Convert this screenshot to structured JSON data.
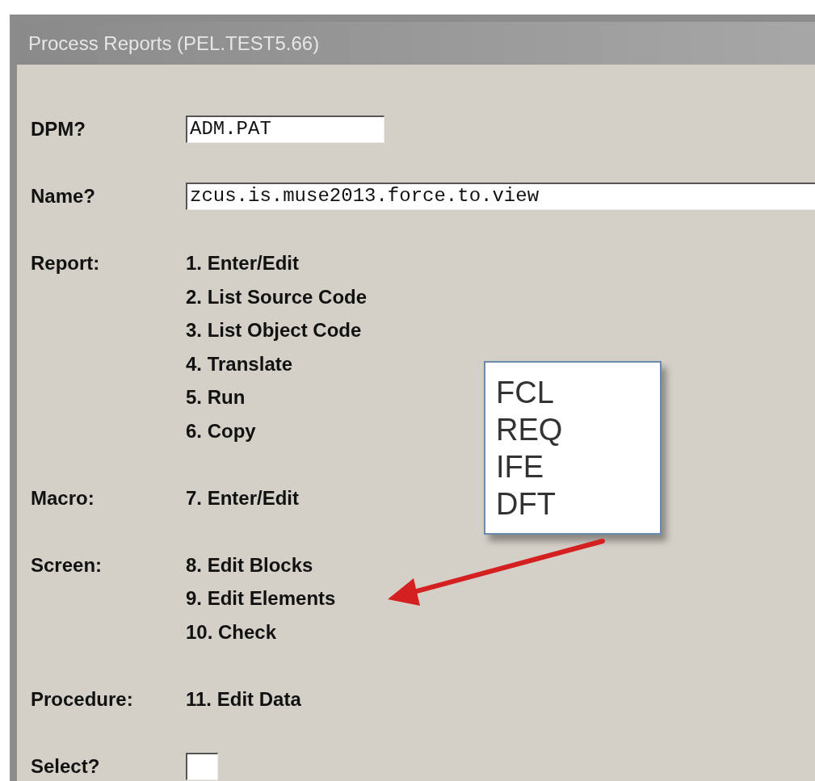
{
  "window": {
    "title": "Process Reports (PEL.TEST5.66)"
  },
  "fields": [
    {
      "label": "DPM?",
      "value": "ADM.PAT",
      "kind": "short"
    },
    {
      "label": "Name?",
      "value": "zcus.is.muse2013.force.to.view",
      "kind": "long"
    }
  ],
  "sections": [
    {
      "label": "Report:",
      "options": [
        "1. Enter/Edit",
        "2. List Source Code",
        "3. List Object Code",
        "4. Translate",
        "5. Run",
        "6. Copy"
      ]
    },
    {
      "label": "Macro:",
      "options": [
        "7. Enter/Edit"
      ]
    },
    {
      "label": "Screen:",
      "options": [
        "8. Edit Blocks",
        "9. Edit Elements",
        "10. Check"
      ]
    },
    {
      "label": "Procedure:",
      "options": [
        "11. Edit Data"
      ]
    }
  ],
  "select": {
    "label": "Select?"
  },
  "callout": {
    "lines": [
      "FCL",
      "REQ",
      "IFE",
      "DFT"
    ]
  }
}
